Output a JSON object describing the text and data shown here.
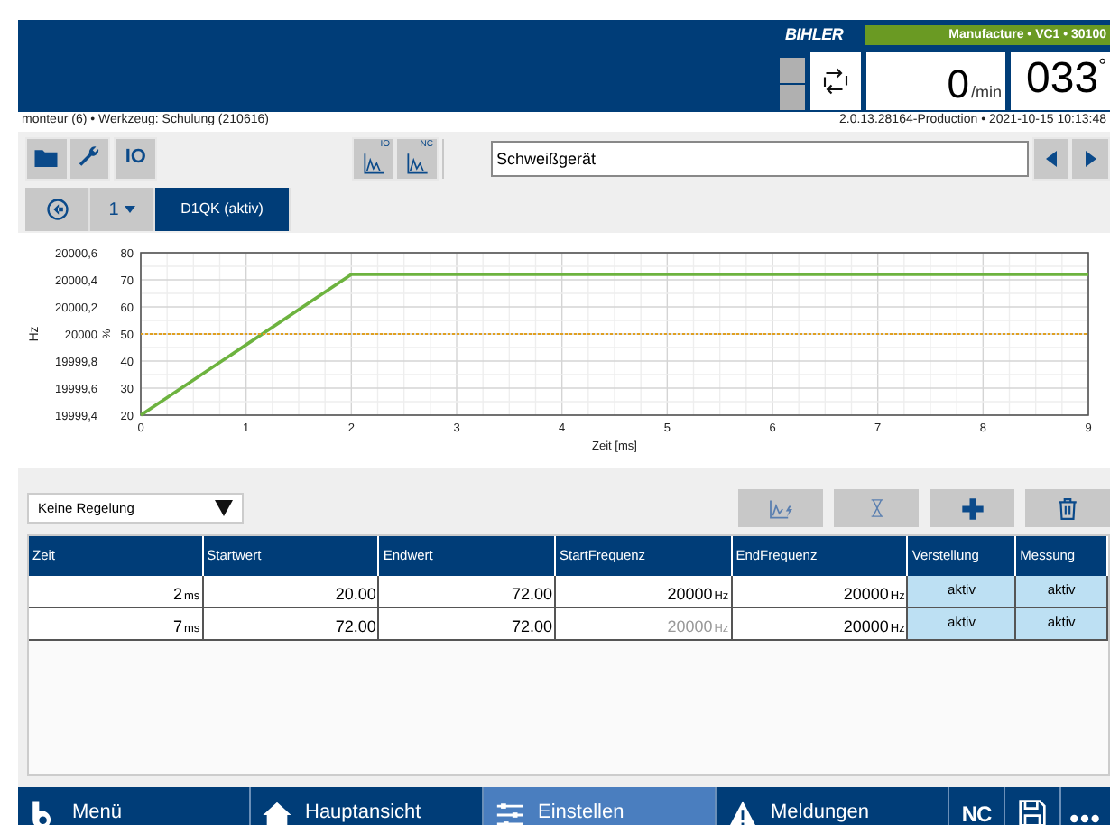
{
  "header": {
    "logo": "BIHLER",
    "mode_bar": "Manufacture • VC1 • 30100",
    "speed": {
      "value": "0",
      "unit": "/min"
    },
    "angle": {
      "value": "033",
      "unit": "°"
    }
  },
  "status_line": {
    "left": "monteur (6) • Werkzeug: Schulung (210616)",
    "right": "2.0.13.28164-Production • 2021-10-15 10:13:48"
  },
  "toolbar": {
    "io_button": "IO",
    "curve_buttons": [
      {
        "badge": "IO"
      },
      {
        "badge": "NC"
      }
    ],
    "device_field": {
      "value": "Schweißgerät"
    }
  },
  "tabs": [
    {
      "kind": "back",
      "selected": false
    },
    {
      "kind": "dropdown",
      "label": "1",
      "selected": false
    },
    {
      "kind": "tab",
      "label": "D1QK (aktiv)",
      "selected": true
    }
  ],
  "chart_data": {
    "type": "line",
    "xlabel": "Zeit [ms]",
    "ylabel": "%",
    "y2label": "Hz",
    "x": [
      0,
      2,
      9
    ],
    "xlim": [
      0,
      9
    ],
    "ylim": [
      20,
      80
    ],
    "xticks": [
      0,
      1,
      2,
      3,
      4,
      5,
      6,
      7,
      8,
      9
    ],
    "yticks": [
      20,
      30,
      40,
      50,
      60,
      70,
      80
    ],
    "y2lim": [
      19999.4,
      20000.6
    ],
    "y2ticks": [
      {
        "value": 19999.4,
        "label": "19999,4"
      },
      {
        "value": 19999.6,
        "label": "19999,6"
      },
      {
        "value": 19999.8,
        "label": "19999,8"
      },
      {
        "value": 20000,
        "label": "20000"
      },
      {
        "value": 20000.2,
        "label": "20000,2"
      },
      {
        "value": 20000.4,
        "label": "20000,4"
      },
      {
        "value": 20000.6,
        "label": "20000,6"
      }
    ],
    "grid": true,
    "series": [
      {
        "color": "#6db33f",
        "line_style": "solid",
        "values": [
          20,
          72,
          72
        ]
      },
      {
        "color": "#e0a020",
        "line_style": "dotted",
        "values": [
          50,
          50,
          50
        ]
      }
    ]
  },
  "regulation_select": {
    "value": "Keine Regelung"
  },
  "table": {
    "columns": [
      "Zeit",
      "Startwert",
      "Endwert",
      "StartFrequenz",
      "EndFrequenz",
      "Verstellung",
      "Messung"
    ],
    "rows": [
      {
        "cells": [
          {
            "kind": "number",
            "text": "2",
            "unit": "ms",
            "disabled": false
          },
          {
            "kind": "number",
            "text": "20.00",
            "disabled": false
          },
          {
            "kind": "number",
            "text": "72.00",
            "disabled": false
          },
          {
            "kind": "number",
            "text": "20000",
            "unit": "Hz",
            "disabled": false
          },
          {
            "kind": "number",
            "text": "20000",
            "unit": "Hz",
            "disabled": false
          },
          {
            "kind": "toggle",
            "text": "aktiv",
            "disabled": false
          },
          {
            "kind": "toggle",
            "text": "aktiv",
            "disabled": false
          }
        ]
      },
      {
        "cells": [
          {
            "kind": "number",
            "text": "7",
            "unit": "ms",
            "disabled": false
          },
          {
            "kind": "number",
            "text": "72.00",
            "disabled": false
          },
          {
            "kind": "number",
            "text": "72.00",
            "disabled": false
          },
          {
            "kind": "number",
            "text": "20000",
            "unit": "Hz",
            "disabled": true
          },
          {
            "kind": "number",
            "text": "20000",
            "unit": "Hz",
            "disabled": false
          },
          {
            "kind": "toggle",
            "text": "aktiv",
            "disabled": false
          },
          {
            "kind": "toggle",
            "text": "aktiv",
            "disabled": false
          }
        ]
      }
    ]
  },
  "nav": [
    {
      "kind": "menu",
      "label": "Menü",
      "selected": false
    },
    {
      "kind": "home",
      "label": "Hauptansicht",
      "selected": false
    },
    {
      "kind": "settings",
      "label": "Einstellen",
      "selected": true
    },
    {
      "kind": "alerts",
      "label": "Meldungen",
      "selected": false
    }
  ],
  "nav_extra": {
    "nc": "NC"
  }
}
